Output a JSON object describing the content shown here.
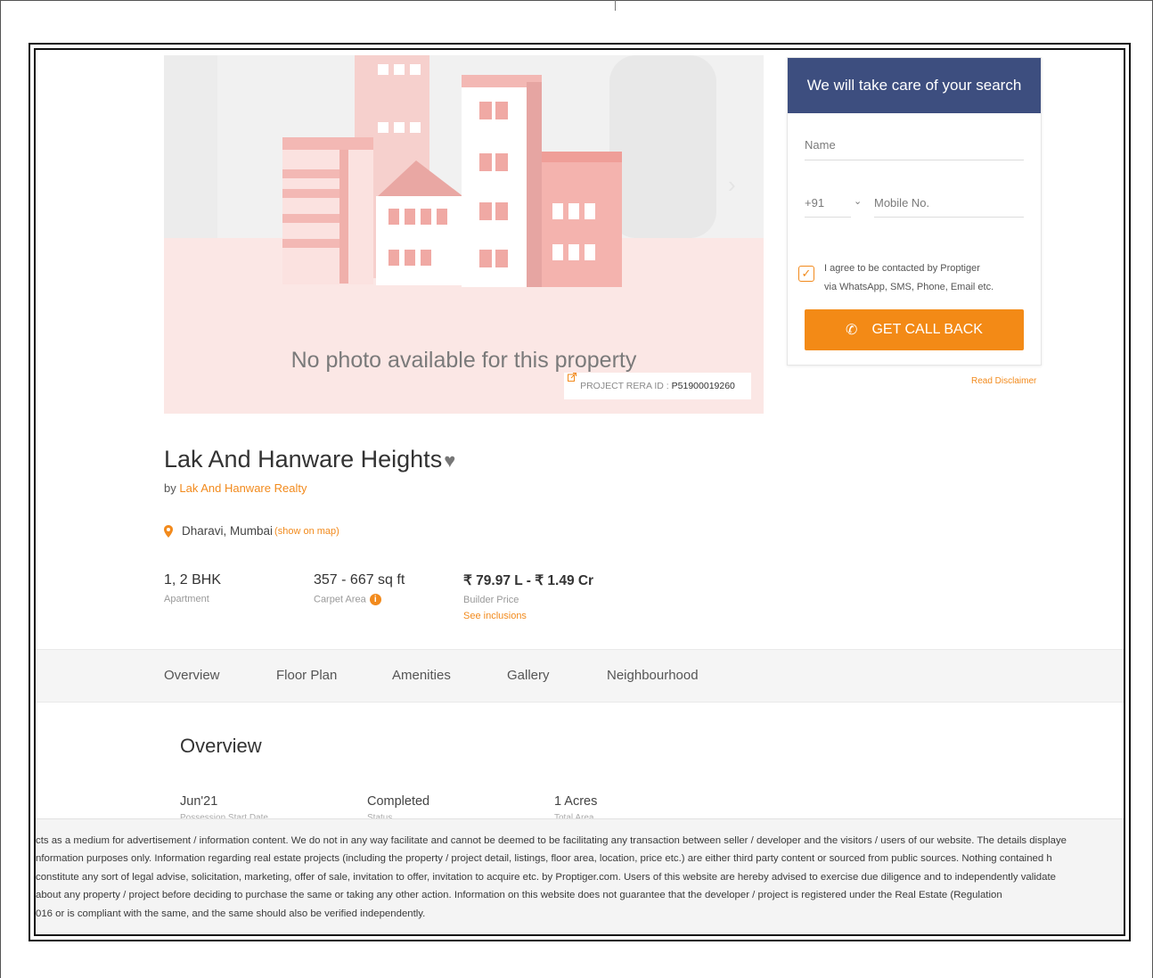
{
  "form": {
    "heading": "We will take care of your search",
    "name_placeholder": "Name",
    "country_code": "+91",
    "mobile_placeholder": "Mobile No.",
    "consent_line1": "I agree to be contacted by Proptiger",
    "consent_line2": "via WhatsApp, SMS, Phone, Email etc.",
    "consent_checked": true,
    "callback_label": "GET CALL BACK",
    "read_disclaimer": "Read Disclaimer"
  },
  "hero": {
    "no_photo_text": "No photo available for this property",
    "rera_label": "PROJECT RERA ID :",
    "rera_id": "P51900019260"
  },
  "project": {
    "name": "Lak And Hanware Heights",
    "by_prefix": "by",
    "builder": "Lak And Hanware Realty",
    "location": "Dharavi, Mumbai",
    "show_on_map": "(show on map)"
  },
  "stats": {
    "config_value": "1, 2 BHK",
    "config_label": "Apartment",
    "area_value": "357 - 667 sq ft",
    "area_label": "Carpet Area",
    "price_value": "₹ 79.97 L - ₹ 1.49 Cr",
    "price_label": "Builder Price",
    "see_inclusions": "See inclusions"
  },
  "tabs": [
    "Overview",
    "Floor Plan",
    "Amenities",
    "Gallery",
    "Neighbourhood"
  ],
  "overview": {
    "title": "Overview",
    "possession_value": "Jun'21",
    "possession_label": "Possession Start Date",
    "status_value": "Completed",
    "status_label": "Status",
    "area_value": "1 Acres",
    "area_label": "Total Area"
  },
  "footer_lines": [
    "cts as a medium for advertisement / information content. We do not in any way facilitate and cannot be deemed to be facilitating any transaction between seller / developer and the visitors / users of our website. The details displaye",
    "nformation purposes only. Information regarding real estate projects (including the property / project detail, listings, floor area, location, price etc.) are either third party content or sourced from public sources. Nothing contained h",
    "constitute any sort of legal advise, solicitation, marketing, offer of sale, invitation to offer, invitation to acquire etc. by Proptiger.com. Users of this website are hereby advised to exercise due diligence and to independently validate",
    " about any property / project before deciding to purchase the same or taking any other action. Information on this website does not guarantee that the developer / project is registered under the Real Estate (Regulation",
    "016 or is compliant with the same, and the same should also be verified independently."
  ],
  "colors": {
    "accent": "#f38a16",
    "form_header": "#3d4e7f"
  }
}
